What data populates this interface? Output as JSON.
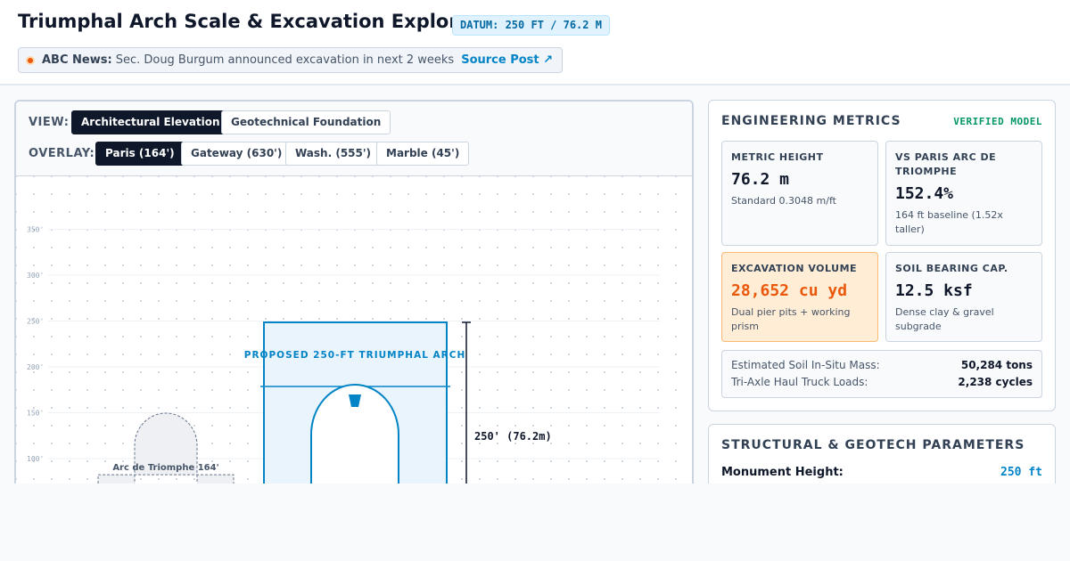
{
  "header": {
    "title": "Triumphal Arch Scale & Excavation Explorer",
    "datum": "DATUM: 250 FT / 76.2 M",
    "news_source": "ABC News:",
    "news_text": "Sec. Doug Burgum announced excavation in next 2 weeks",
    "news_link": "Source Post ↗"
  },
  "controls": {
    "view_label": "VIEW:",
    "view_options": [
      "Architectural Elevation",
      "Geotechnical Foundation"
    ],
    "view_selected": "Architectural Elevation",
    "overlay_label": "OVERLAY:",
    "overlay_options": [
      "Paris (164')",
      "Gateway (630')",
      "Wash. (555')",
      "Marble (45')"
    ],
    "overlay_selected": "Paris (164')"
  },
  "canvas": {
    "scale_ticks": [
      100,
      150,
      200,
      250,
      300,
      350
    ],
    "scale_unit_suffix": "'",
    "paris_label": "Arc de Triomphe 164'",
    "paris_height_ft": 164,
    "proposed_label": "PROPOSED 250-FT TRIUMPHAL ARCH",
    "proposed_height_ft": 250,
    "dimension_label": "250' (76.2m)"
  },
  "metrics": {
    "title": "ENGINEERING METRICS",
    "badge": "VERIFIED MODEL",
    "cards": [
      {
        "label": "METRIC HEIGHT",
        "value": "76.2 m",
        "sub": "Standard 0.3048 m/ft"
      },
      {
        "label": "VS PARIS ARC DE TRIOMPHE",
        "value": "152.4%",
        "sub": "164 ft baseline (1.52x taller)"
      },
      {
        "label": "EXCAVATION VOLUME",
        "value": "28,652 cu yd",
        "sub": "Dual pier pits + working prism"
      },
      {
        "label": "SOIL BEARING CAP.",
        "value": "12.5 ksf",
        "sub": "Dense clay & gravel subgrade"
      }
    ],
    "mass_rows": [
      {
        "label": "Estimated Soil In-Situ Mass:",
        "value": "50,284 tons"
      },
      {
        "label": "Tri-Axle Haul Truck Loads:",
        "value": "2,238 cycles"
      }
    ]
  },
  "params": {
    "title": "STRUCTURAL & GEOTECH PARAMETERS",
    "rows": [
      {
        "label": "Monument Height:",
        "value": "250 ft"
      }
    ]
  },
  "colors": {
    "accent": "#0284c7",
    "proposed_fill": "#eaf4fd",
    "paris_fill": "#eef0f3",
    "warning": "#ea580c",
    "verified": "#059669"
  }
}
